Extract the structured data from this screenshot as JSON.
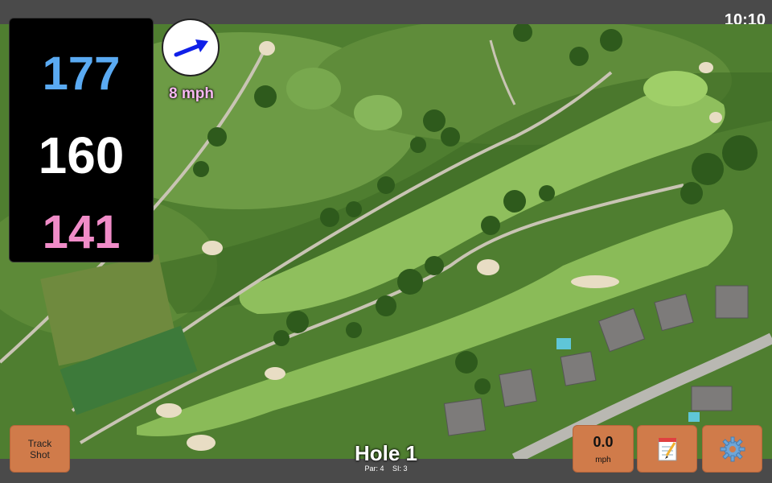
{
  "status_bar": {
    "time": "10:10"
  },
  "distances": {
    "back": {
      "value": "177",
      "color": "#5aaaf2"
    },
    "middle": {
      "value": "160",
      "color": "#ffffff"
    },
    "front": {
      "value": "141",
      "color": "#f08cc8"
    }
  },
  "wind": {
    "speed_label": "8 mph",
    "arrow_icon": "wind-direction-arrow-icon",
    "arrow_color": "#1020e8"
  },
  "hole": {
    "title": "Hole 1",
    "par": "Par: 4",
    "stroke_index": "SI: 3"
  },
  "buttons": {
    "track_shot_line1": "Track",
    "track_shot_line2": "Shot",
    "speed_value": "0.0",
    "speed_unit": "mph",
    "notes_icon": "notepad-icon",
    "settings_icon": "gear-icon",
    "accent_color": "#d07b4a"
  },
  "map": {
    "type": "satellite-aerial-golf-course"
  }
}
